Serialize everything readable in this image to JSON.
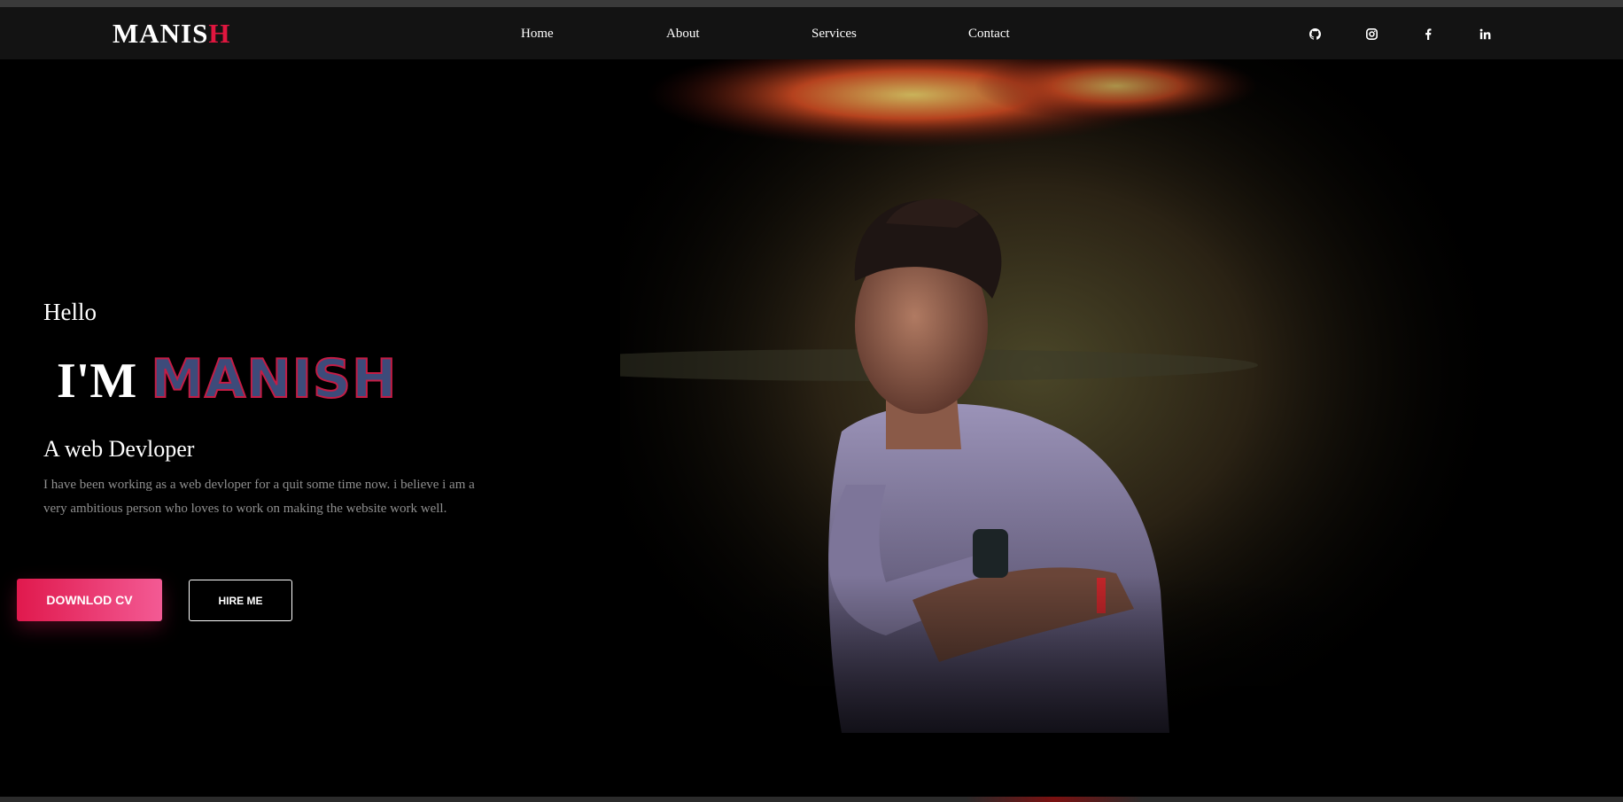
{
  "nav": {
    "logo_main": "MANIS",
    "logo_accent": "H",
    "links": [
      "Home",
      "About",
      "Services",
      "Contact"
    ],
    "social_icons": [
      "github-icon",
      "instagram-icon",
      "facebook-icon",
      "linkedin-icon"
    ]
  },
  "hero": {
    "greeting": "Hello",
    "im": "I'M",
    "name": "MANISH",
    "role": "A web Devloper",
    "description": "I have been working as a web devloper for a quit some time now. i believe i am a very ambitious person who loves to work on making the website work well.",
    "download_label": "DOWNLOD CV",
    "hire_label": "HIRE ME"
  },
  "colors": {
    "accent": "#e0163f",
    "nav_bg": "#131313",
    "page_bg": "#000000",
    "button_gradient_start": "#e0194d",
    "button_gradient_end": "#f35a94"
  }
}
